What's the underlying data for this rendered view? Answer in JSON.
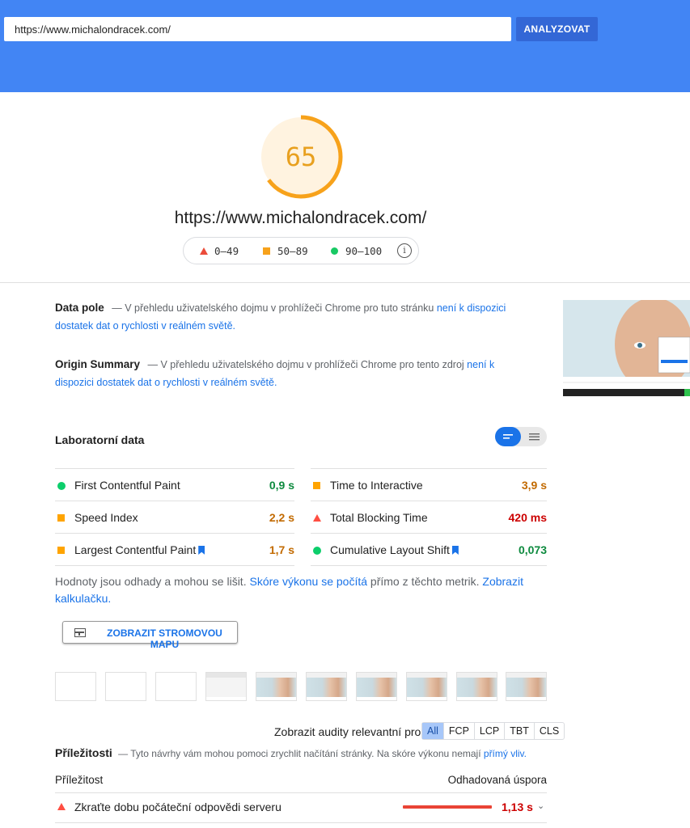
{
  "search": {
    "url_value": "https://www.michalondracek.com/",
    "analyze_label": "ANALYZOVAT"
  },
  "score": {
    "value": "65",
    "fraction": 0.65,
    "color": "#f7a21b"
  },
  "page_url": "https://www.michalondracek.com/",
  "legend": {
    "fail": "0–49",
    "average": "50–89",
    "pass": "90–100",
    "info_icon": "info-icon"
  },
  "field_data": {
    "title": "Data pole",
    "text_prefix": "— V přehledu uživatelského dojmu v prohlížeči Chrome pro tuto stránku",
    "link": "není k dispozici dostatek dat o rychlosti v reálném světě."
  },
  "origin_summary": {
    "title": "Origin Summary",
    "text_prefix": "— V přehledu uživatelského dojmu v prohlížeči Chrome pro tento zdroj",
    "link": "není k dispozici dostatek dat o rychlosti v reálném světě."
  },
  "lab": {
    "title": "Laboratorní data",
    "metrics": [
      {
        "label": "First Contentful Paint",
        "value": "0,9 s",
        "status": "pass"
      },
      {
        "label": "Time to Interactive",
        "value": "3,9 s",
        "status": "average"
      },
      {
        "label": "Speed Index",
        "value": "2,2 s",
        "status": "average"
      },
      {
        "label": "Total Blocking Time",
        "value": "420 ms",
        "status": "fail"
      },
      {
        "label": "Largest Contentful Paint",
        "value": "1,7 s",
        "status": "average"
      },
      {
        "label": "Cumulative Layout Shift",
        "value": "0,073",
        "status": "pass"
      }
    ]
  },
  "note": {
    "text1": "Hodnoty jsou odhady a mohou se lišit.",
    "link1": "Skóre výkonu se počítá",
    "text2": "přímo z těchto metrik.",
    "link2": "Zobrazit kalkulačku."
  },
  "treemap_button": "ZOBRAZIT STROMOVOU MAPU",
  "filter": {
    "label": "Zobrazit audity relevantní pro:",
    "chips": [
      "All",
      "FCP",
      "LCP",
      "TBT",
      "CLS"
    ]
  },
  "opportunities": {
    "title": "Příležitosti",
    "text": "— Tyto návrhy vám mohou pomoci zrychlit načítání stránky. Na skóre výkonu nemají",
    "link": "přímý vliv.",
    "col_left": "Příležitost",
    "col_right": "Odhadovaná úspora",
    "items": [
      {
        "label": "Zkraťte dobu počáteční odpovědi serveru",
        "value": "1,13 s",
        "status": "fail"
      }
    ]
  }
}
